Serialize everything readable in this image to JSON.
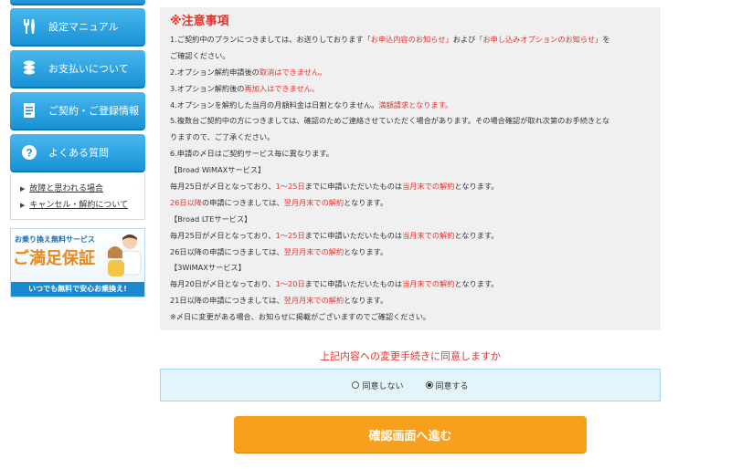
{
  "sidebar": {
    "menu": [
      {
        "label": "設定マニュアル",
        "icon": "tools-icon"
      },
      {
        "label": "お支払いについて",
        "icon": "coins-icon"
      },
      {
        "label": "ご契約・ご登録情報",
        "icon": "document-icon"
      },
      {
        "label": "よくある質問",
        "icon": "question-icon"
      }
    ],
    "links": [
      "故障と思われる場合",
      "キャンセル・解約について"
    ],
    "banner": {
      "top": "お乗り換え無料サービス",
      "main": "ご満足保証",
      "bottom": "いつでも無料で安心お乗換え!"
    }
  },
  "notice": {
    "title": "※注意事項",
    "lines": [
      [
        {
          "t": "1.ご契約中のプランにつきましては、お送りしております"
        },
        {
          "t": "「お申込内容のお知らせ」",
          "red": true
        },
        {
          "t": "および"
        },
        {
          "t": "「お申し込みオプションのお知らせ」",
          "red": true
        },
        {
          "t": "を"
        }
      ],
      [
        {
          "t": "ご確認ください。"
        }
      ],
      [
        {
          "t": "2.オプション解約申請後の"
        },
        {
          "t": "取消はできません。",
          "red": true
        }
      ],
      [
        {
          "t": "3.オプション解約後の"
        },
        {
          "t": "再加入はできません。",
          "red": true
        }
      ],
      [
        {
          "t": "4.オプションを解約した当月の月額料金は日割となりません。"
        },
        {
          "t": "満額請求となります。",
          "red": true
        }
      ],
      [
        {
          "t": "5.複数台ご契約中の方につきましては、確認のためご連絡させていただく場合があります。その場合確認が取れ次第のお手続きとな"
        }
      ],
      [
        {
          "t": "りますので、ご了承ください。"
        }
      ],
      [
        {
          "t": "6.申請の〆日はご契約サービス毎に異なります。"
        }
      ],
      [
        {
          "t": "【Broad WiMAXサービス】"
        }
      ],
      [
        {
          "t": "毎月25日が〆日となっており、"
        },
        {
          "t": "1〜25日",
          "red": true
        },
        {
          "t": "までに申請いただいたものは"
        },
        {
          "t": "当月末での解約",
          "red": true
        },
        {
          "t": "となります。"
        }
      ],
      [
        {
          "t": "26日以降",
          "red": true
        },
        {
          "t": "の申請につきましては、"
        },
        {
          "t": "翌月月末での解約",
          "red": true
        },
        {
          "t": "となります。"
        }
      ],
      [
        {
          "t": "【Broad LTEサービス】"
        }
      ],
      [
        {
          "t": "毎月25日が〆日となっており、"
        },
        {
          "t": "1〜25日",
          "red": true
        },
        {
          "t": "までに申請いただいたものは"
        },
        {
          "t": "当月末での解約",
          "red": true
        },
        {
          "t": "となります。"
        }
      ],
      [
        {
          "t": "26日以降の申請につきましては、"
        },
        {
          "t": "翌月月末での解約",
          "red": true
        },
        {
          "t": "となります。"
        }
      ],
      [
        {
          "t": "【3WiMAXサービス】"
        }
      ],
      [
        {
          "t": "毎月20日が〆日となっており、"
        },
        {
          "t": "1〜20日",
          "red": true
        },
        {
          "t": "までに申請いただいたものは"
        },
        {
          "t": "当月末での解約",
          "red": true
        },
        {
          "t": "となります。"
        }
      ],
      [
        {
          "t": "21日以降の申請につきましては、"
        },
        {
          "t": "翌月月末での解約",
          "red": true
        },
        {
          "t": "となります。"
        }
      ],
      [
        {
          "t": "※〆日に変更がある場合、お知らせに掲載がございますのでご確認ください。"
        }
      ]
    ]
  },
  "agreement": {
    "question": "上記内容への変更手続きに同意しますか",
    "options": [
      {
        "label": "同意しない",
        "checked": false
      },
      {
        "label": "同意する",
        "checked": true
      }
    ]
  },
  "submit_label": "確認画面へ進む"
}
